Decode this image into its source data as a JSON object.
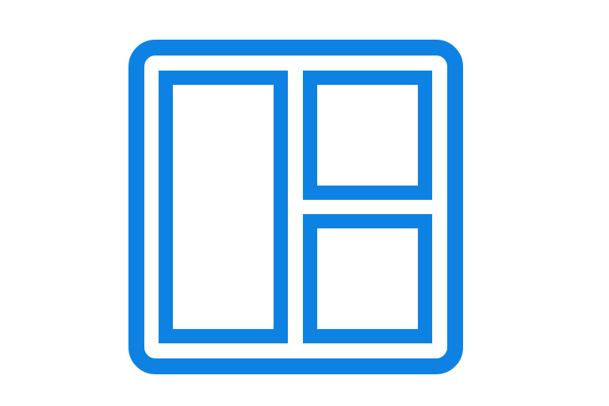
{
  "icon": {
    "name": "dashboard-layout-icon",
    "color": "#0d82e3",
    "background": "#ffffff"
  }
}
